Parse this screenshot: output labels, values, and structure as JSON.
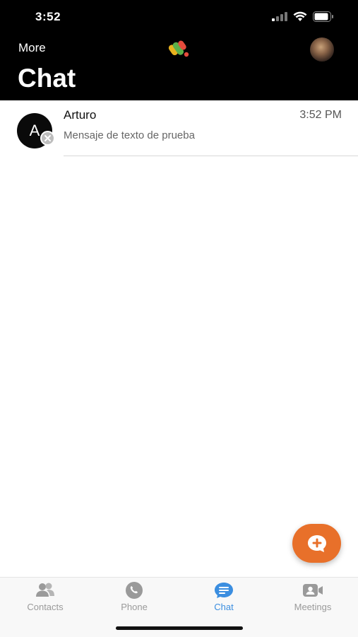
{
  "status_bar": {
    "time": "3:52"
  },
  "header": {
    "more_label": "More",
    "title": "Chat"
  },
  "chats": [
    {
      "avatar_initial": "A",
      "name": "Arturo",
      "time": "3:52 PM",
      "preview": "Mensaje de texto de prueba"
    }
  ],
  "tabs": [
    {
      "label": "Contacts",
      "icon": "contacts-icon",
      "active": false
    },
    {
      "label": "Phone",
      "icon": "phone-icon",
      "active": false
    },
    {
      "label": "Chat",
      "icon": "chat-icon",
      "active": true
    },
    {
      "label": "Meetings",
      "icon": "meetings-icon",
      "active": false
    }
  ],
  "colors": {
    "accent": "#e8702a",
    "active_tab": "#3b8ee0",
    "inactive_tab": "#9a9a9a",
    "header_bg": "#000000"
  }
}
